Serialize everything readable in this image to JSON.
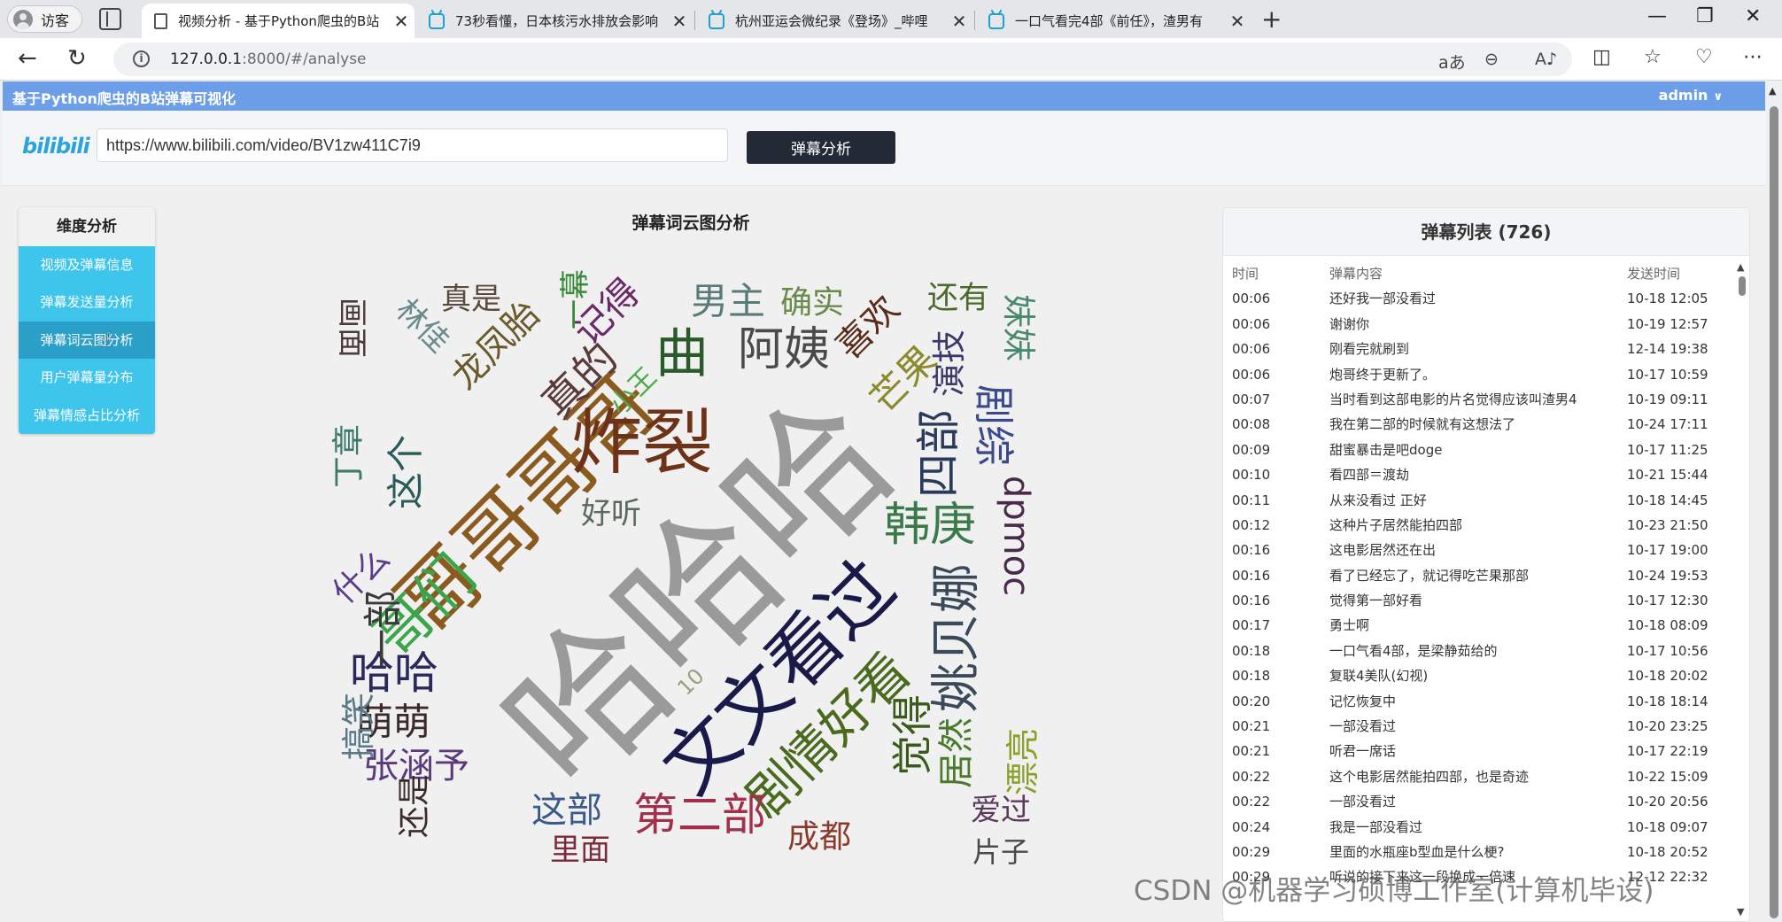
{
  "browser": {
    "profile_label": "访客",
    "tabs": [
      {
        "title": "视频分析 - 基于Python爬虫的B站",
        "active": true,
        "favicon": "document-icon"
      },
      {
        "title": "73秒看懂，日本核污水排放会影响",
        "active": false,
        "favicon": "bilibili-tv-icon"
      },
      {
        "title": "杭州亚运会微纪录《登场》_哔哩",
        "active": false,
        "favicon": "bilibili-tv-icon"
      },
      {
        "title": "一口气看完4部《前任》，渣男有",
        "active": false,
        "favicon": "bilibili-tv-icon"
      }
    ],
    "url_host": "127.0.0.1",
    "url_path": ":8000/#/analyse"
  },
  "app": {
    "title": "基于Python爬虫的B站弹幕可视化",
    "user": "admin",
    "logo_text": "bilibili",
    "video_url": "https://www.bilibili.com/video/BV1zw411C7i9",
    "analyse_button": "弹幕分析"
  },
  "sidemenu": {
    "header": "维度分析",
    "items": [
      "视频及弹幕信息",
      "弹幕发送量分析",
      "弹幕词云图分析",
      "用户弹幕量分布",
      "弹幕情感占比分析"
    ],
    "selected_index": 2
  },
  "wordcloud": {
    "title": "弹幕词云图分析",
    "words": [
      {
        "text": "哈哈哈",
        "color": "#9a9a9a"
      },
      {
        "text": "哥哥哥哥",
        "color": "#8b5a1e"
      },
      {
        "text": "炸裂",
        "color": "#6e3219"
      },
      {
        "text": "文文看过",
        "color": "#1a1a4a"
      },
      {
        "text": "剧情好看",
        "color": "#4a6a1e"
      },
      {
        "text": "哥们",
        "color": "#3aa54a"
      },
      {
        "text": "姚贝娜",
        "color": "#3a4a5a"
      },
      {
        "text": "韩庚",
        "color": "#3a7a4a"
      },
      {
        "text": "第二部",
        "color": "#a3304a"
      },
      {
        "text": "阿姨",
        "color": "#4a4a4a"
      },
      {
        "text": "真的",
        "color": "#5a3a3a"
      },
      {
        "text": "龙凤胎",
        "color": "#6a5a2a"
      },
      {
        "text": "记得",
        "color": "#6a2a6a"
      },
      {
        "text": "男主",
        "color": "#5a7a7a"
      },
      {
        "text": "确实",
        "color": "#6a8a4a"
      },
      {
        "text": "喜欢",
        "color": "#5a2a1a"
      },
      {
        "text": "还有",
        "color": "#4a6a2a"
      },
      {
        "text": "演技",
        "color": "#3a3a6a"
      },
      {
        "text": "芒果",
        "color": "#8a8a2a"
      },
      {
        "text": "四部",
        "color": "#2a3a5a"
      },
      {
        "text": "剧综",
        "color": "#3a4a8a"
      },
      {
        "text": "这个",
        "color": "#2a5a5a"
      },
      {
        "text": "好听",
        "color": "#5a6a5a"
      },
      {
        "text": "哈哈",
        "color": "#2a2a5a"
      },
      {
        "text": "萌萌",
        "color": "#3a2a2a"
      },
      {
        "text": "张涵予",
        "color": "#5a3a7a"
      },
      {
        "text": "这部",
        "color": "#3a5a8a"
      },
      {
        "text": "成都",
        "color": "#8a3a2a"
      },
      {
        "text": "里面",
        "color": "#7a2a3a"
      },
      {
        "text": "觉得",
        "color": "#3a5a1a"
      },
      {
        "text": "居然",
        "color": "#4a7a2a"
      },
      {
        "text": "漂亮",
        "color": "#8aa02a"
      },
      {
        "text": "爱过",
        "color": "#5a3a5a"
      },
      {
        "text": "片子",
        "color": "#4a4a4a"
      },
      {
        "text": "真是",
        "color": "#5a4a3a"
      },
      {
        "text": "林佳",
        "color": "#6a8a8a"
      },
      {
        "text": "画面",
        "color": "#4a3a3a"
      },
      {
        "text": "小王",
        "color": "#4aaa4a"
      },
      {
        "text": "一幕",
        "color": "#3a8a3a"
      },
      {
        "text": "曲",
        "color": "#2a5a2a"
      },
      {
        "text": "一部",
        "color": "#3a3a3a"
      },
      {
        "text": "什么",
        "color": "#5a3a8a"
      },
      {
        "text": "搞笑",
        "color": "#5a7a8a"
      },
      {
        "text": "还是",
        "color": "#3a2a2a"
      },
      {
        "text": "dpmoc",
        "color": "#4a2a4a"
      },
      {
        "text": "妹妹",
        "color": "#4a8a6a"
      },
      {
        "text": "丁章",
        "color": "#3a7a6a"
      },
      {
        "text": "10",
        "color": "#9aa07a"
      }
    ]
  },
  "danmu_list": {
    "title": "弹幕列表 (726)",
    "columns": [
      "时间",
      "弹幕内容",
      "发送时间"
    ],
    "rows": [
      [
        "00:06",
        "还好我一部没看过",
        "10-18 12:05"
      ],
      [
        "00:06",
        "谢谢你",
        "10-19 12:57"
      ],
      [
        "00:06",
        "刚看完就刷到",
        "12-14 19:38"
      ],
      [
        "00:06",
        "炮哥终于更新了。",
        "10-17 10:59"
      ],
      [
        "00:07",
        "当时看到这部电影的片名觉得应该叫渣男4",
        "10-19 09:11"
      ],
      [
        "00:08",
        "我在第二部的时候就有这想法了",
        "10-24 17:11"
      ],
      [
        "00:09",
        "甜蜜暴击是吧doge",
        "10-17 11:25"
      ],
      [
        "00:10",
        "看四部＝渡劫",
        "10-21 15:44"
      ],
      [
        "00:11",
        "从来没看过 正好",
        "10-18 14:45"
      ],
      [
        "00:12",
        "这种片子居然能拍四部",
        "10-23 21:50"
      ],
      [
        "00:16",
        "这电影居然还在出",
        "10-17 19:00"
      ],
      [
        "00:16",
        "看了已经忘了，就记得吃芒果那部",
        "10-24 19:53"
      ],
      [
        "00:16",
        "觉得第一部好看",
        "10-17 12:30"
      ],
      [
        "00:17",
        "勇士啊",
        "10-18 08:09"
      ],
      [
        "00:18",
        "一口气看4部，是梁静茹给的",
        "10-17 10:56"
      ],
      [
        "00:18",
        "复联4美队(幻视)",
        "10-18 20:02"
      ],
      [
        "00:20",
        "记忆恢复中",
        "10-18 18:14"
      ],
      [
        "00:21",
        "一部没看过",
        "10-20 23:25"
      ],
      [
        "00:21",
        "听君一席话",
        "10-17 22:19"
      ],
      [
        "00:22",
        "这个电影居然能拍四部，也是奇迹",
        "10-22 15:09"
      ],
      [
        "00:22",
        "一部没看过",
        "10-20 20:56"
      ],
      [
        "00:24",
        "我是一部没看过",
        "10-18 09:07"
      ],
      [
        "00:29",
        "里面的水瓶座b型血是什么梗?",
        "10-18 20:52"
      ],
      [
        "00:29",
        "听说的接下来这一段换成一倍速",
        "12-12 22:32"
      ]
    ]
  },
  "watermark": "CSDN @机器学习硕博工作室(计算机毕设)"
}
